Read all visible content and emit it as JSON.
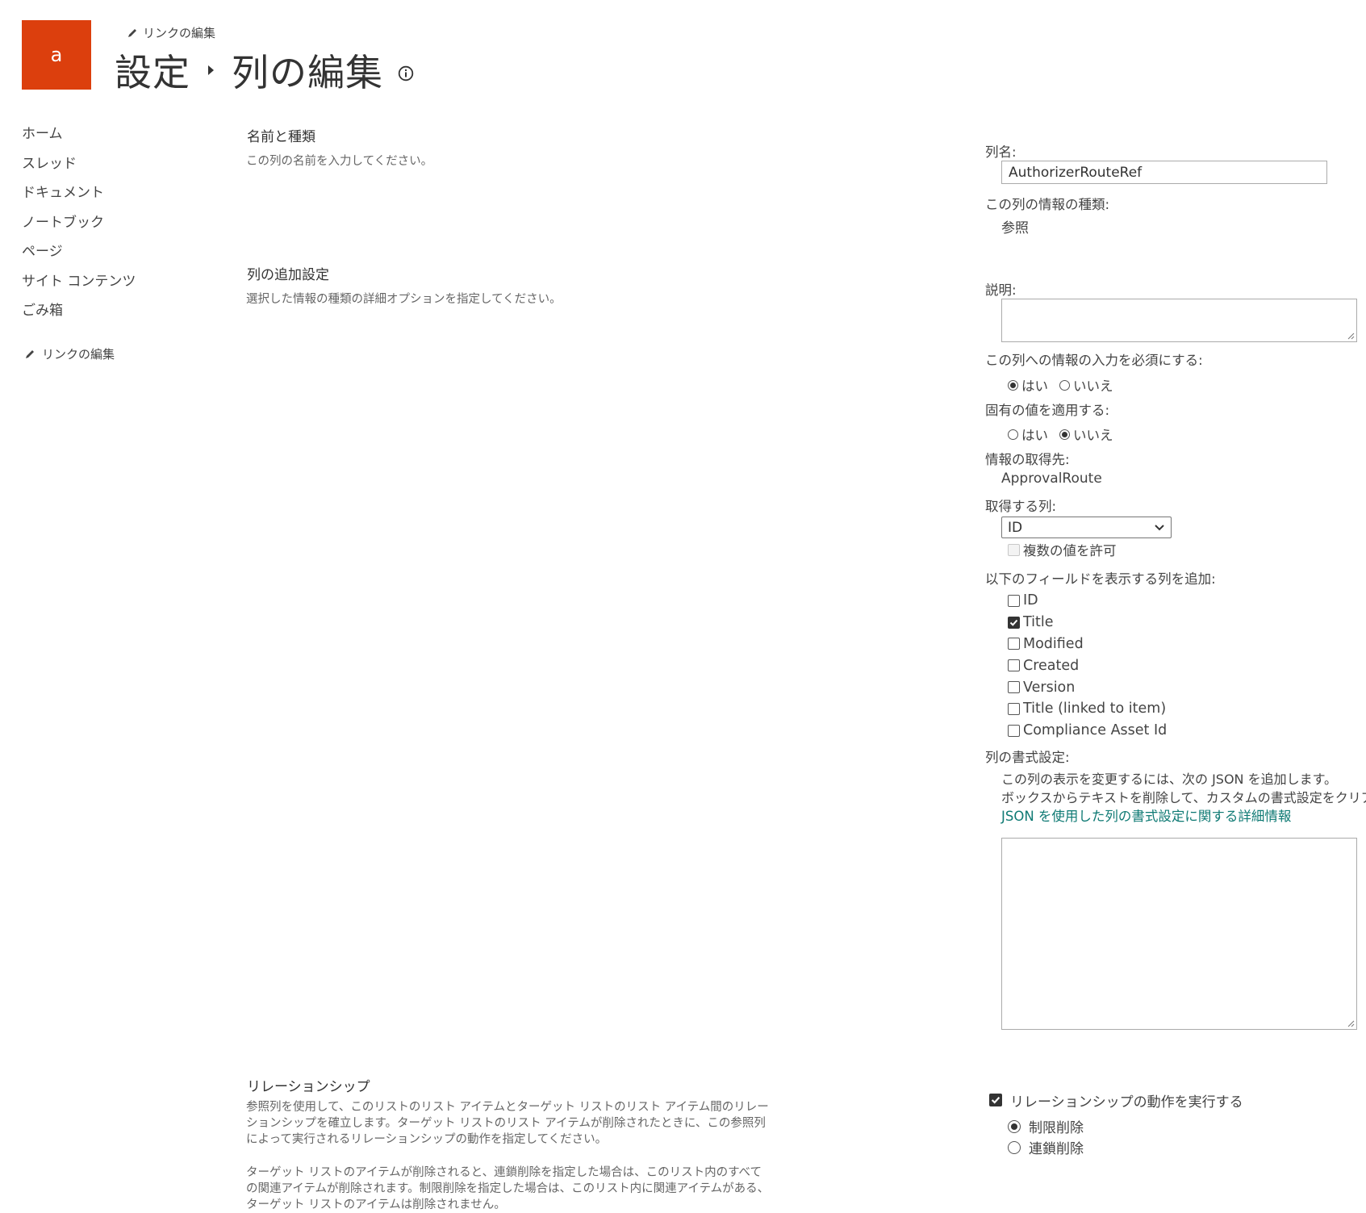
{
  "header": {
    "logo_letter": "a",
    "edit_links_label": "リンクの編集",
    "breadcrumb_root": "設定",
    "page_title": "列の編集"
  },
  "nav": {
    "items": [
      "ホーム",
      "スレッド",
      "ドキュメント",
      "ノートブック",
      "ページ",
      "サイト コンテンツ",
      "ごみ箱"
    ],
    "edit_links_label": "リンクの編集"
  },
  "sections": {
    "name_type": {
      "title": "名前と種類",
      "desc": "この列の名前を入力してください。"
    },
    "additional": {
      "title": "列の追加設定",
      "desc": "選択した情報の種類の詳細オプションを指定してください。"
    },
    "relationship": {
      "title": "リレーションシップ",
      "para1": "参照列を使用して、このリストのリスト アイテムとターゲット リストのリスト アイテム間のリレーションシップを確立します。ターゲット リストのリスト アイテムが削除されたときに、この参照列によって実行されるリレーションシップの動作を指定してください。",
      "para2": "ターゲット リストのアイテムが削除されると、連鎖削除を指定した場合は、このリスト内のすべての関連アイテムが削除されます。制限削除を指定した場合は、このリスト内に関連アイテムがある、ターゲット リストのアイテムは削除されません。"
    }
  },
  "form": {
    "column_name_label": "列名:",
    "column_name_value": "AuthorizerRouteRef",
    "type_label": "この列の情報の種類:",
    "type_value": "参照",
    "description_label": "説明:",
    "required_label": "この列への情報の入力を必須にする:",
    "required_yes": "はい",
    "required_no": "いいえ",
    "required_selected": "yes",
    "unique_label": "固有の値を適用する:",
    "unique_yes": "はい",
    "unique_no": "いいえ",
    "unique_selected": "no",
    "source_label": "情報の取得先:",
    "source_value": "ApprovalRoute",
    "get_column_label": "取得する列:",
    "get_column_value": "ID",
    "allow_multiple_label": "複数の値を許可",
    "add_fields_label": "以下のフィールドを表示する列を追加:",
    "fields": [
      {
        "label": "ID",
        "checked": false
      },
      {
        "label": "Title",
        "checked": true
      },
      {
        "label": "Modified",
        "checked": false
      },
      {
        "label": "Created",
        "checked": false
      },
      {
        "label": "Version",
        "checked": false
      },
      {
        "label": "Title (linked to item)",
        "checked": false
      },
      {
        "label": "Compliance Asset Id",
        "checked": false
      }
    ],
    "formatting_label": "列の書式設定:",
    "formatting_line1": "この列の表示を変更するには、次の JSON を追加します。",
    "formatting_line2": "ボックスからテキストを削除して、カスタムの書式設定をクリアします。",
    "formatting_link": "JSON を使用した列の書式設定に関する詳細情報",
    "enforce_relationship_label": "リレーションシップの動作を実行する",
    "restrict_delete": "制限削除",
    "cascade_delete": "連鎖削除",
    "delete_selected": "restrict"
  }
}
